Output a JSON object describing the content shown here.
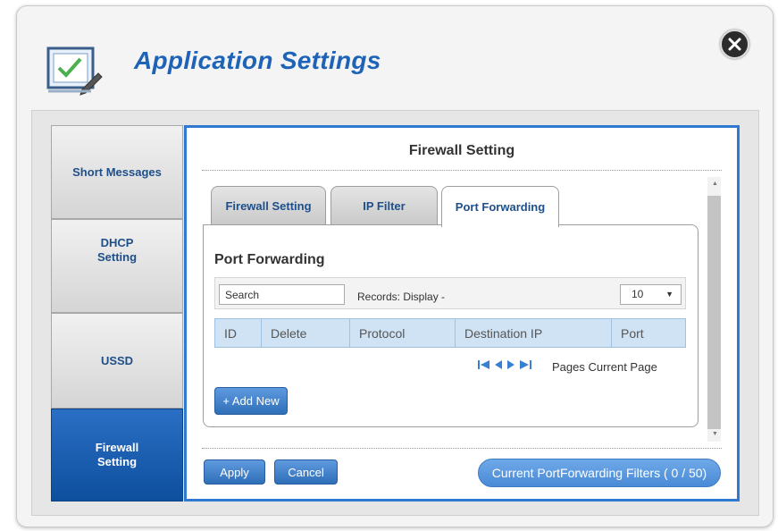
{
  "app": {
    "title": "Application Settings"
  },
  "sidebar": {
    "items": [
      {
        "line1": "Short Messages",
        "line2": ""
      },
      {
        "line1": "DHCP",
        "line2": "Setting"
      },
      {
        "line1": "USSD",
        "line2": ""
      },
      {
        "line1": "Firewall",
        "line2": "Setting"
      }
    ]
  },
  "panel": {
    "title": "Firewall Setting"
  },
  "tabs": [
    {
      "label": "Firewall Setting"
    },
    {
      "label": "IP Filter"
    },
    {
      "label": "Port Forwarding"
    }
  ],
  "port_forwarding": {
    "title": "Port Forwarding",
    "search_placeholder": "Search",
    "records_label": "Records:  Display -",
    "display_count": "10",
    "columns": [
      "ID",
      "Delete",
      "Protocol",
      "Destination IP",
      "Port"
    ],
    "pages_label": "Pages  Current Page",
    "add_new_label": "+ Add New"
  },
  "footer": {
    "apply_label": "Apply",
    "cancel_label": "Cancel",
    "filters_label": "Current PortForwarding Filters ( 0 / 50)"
  },
  "colors": {
    "accent": "#1e63b7",
    "panel_border": "#2f7ad0",
    "active_tab": "#0e4f9e",
    "table_header": "#cfe3f4"
  }
}
